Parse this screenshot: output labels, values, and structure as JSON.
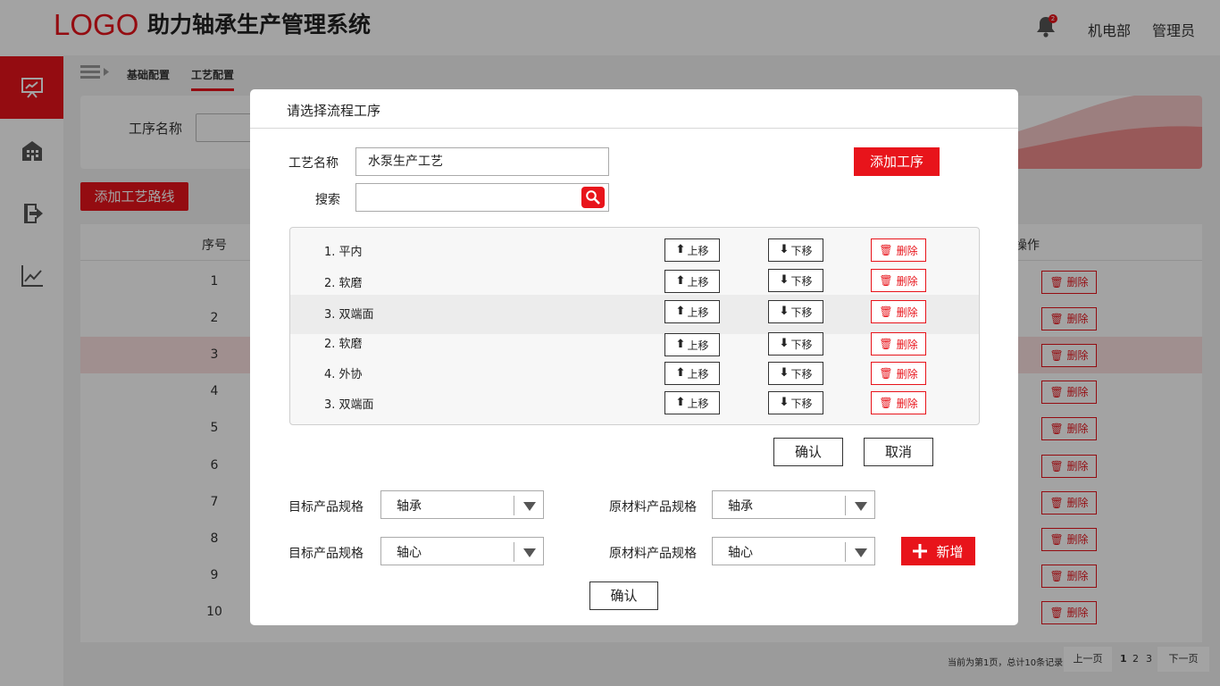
{
  "header": {
    "logo_text": "LOGO",
    "title": "助力轴承生产管理系统",
    "notification_count": "2",
    "department": "机电部",
    "user": "管理员"
  },
  "sidebar": {
    "items": [
      {
        "icon": "presentation-chart-icon",
        "active": true
      },
      {
        "icon": "building-icon",
        "active": false
      },
      {
        "icon": "logout-icon",
        "active": false
      },
      {
        "icon": "trend-chart-icon",
        "active": false
      }
    ]
  },
  "breadcrumb": {
    "items": [
      "基础配置",
      "工艺配置"
    ],
    "active_index": 1
  },
  "filter": {
    "label": "工序名称"
  },
  "toolbar": {
    "add_route_label": "添加工艺路线"
  },
  "table": {
    "headers": {
      "index": "序号",
      "action": "操作"
    },
    "rows": [
      {
        "index": "1",
        "action": "删除"
      },
      {
        "index": "2",
        "action": "删除"
      },
      {
        "index": "3",
        "action": "删除",
        "highlight": true
      },
      {
        "index": "4",
        "action": "删除"
      },
      {
        "index": "5",
        "action": "删除"
      },
      {
        "index": "6",
        "action": "删除"
      },
      {
        "index": "7",
        "action": "删除"
      },
      {
        "index": "8",
        "action": "删除"
      },
      {
        "index": "9",
        "action": "删除"
      },
      {
        "index": "10",
        "action": "删除"
      }
    ]
  },
  "pagination": {
    "info": "当前为第1页，总计10条记录",
    "prev": "上一页",
    "pages": [
      "1",
      "2",
      "3"
    ],
    "current_page": "1",
    "next": "下一页"
  },
  "modal": {
    "title": "请选择流程工序",
    "process_name_label": "工艺名称",
    "process_name_value": "水泵生产工艺",
    "search_label": "搜索",
    "search_value": "",
    "add_step_label": "添加工序",
    "steps": [
      {
        "name": "1. 平内"
      },
      {
        "name": "2. 软磨"
      },
      {
        "name": "3. 双端面",
        "highlight": true
      },
      {
        "name": "2. 软磨"
      },
      {
        "name": "4. 外协"
      },
      {
        "name": "3. 双端面"
      }
    ],
    "move_up_label": "上移",
    "move_down_label": "下移",
    "delete_label": "删除",
    "confirm_label": "确认",
    "cancel_label": "取消",
    "spec_rows": [
      {
        "target_label": "目标产品规格",
        "target_value": "轴承",
        "raw_label": "原材料产品规格",
        "raw_value": "轴承"
      },
      {
        "target_label": "目标产品规格",
        "target_value": "轴心",
        "raw_label": "原材料产品规格",
        "raw_value": "轴心"
      }
    ],
    "new_label": "新增",
    "bottom_confirm_label": "确认"
  },
  "colors": {
    "accent": "#e8141b",
    "overlay": "rgba(0,0,0,0.36)",
    "row_highlight": "#fbe0e0"
  }
}
